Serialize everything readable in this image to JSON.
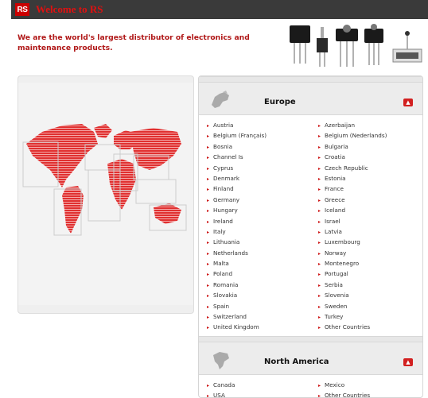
{
  "header": {
    "logo_text": "RS",
    "title": "Welcome to RS"
  },
  "tagline": "We are the world's largest distributor of electronics and maintenance products.",
  "regions": [
    {
      "name": "Europe",
      "countries": [
        "Austria",
        "Azerbaijan",
        "Belgium (Français)",
        "Belgium (Nederlands)",
        "Bosnia",
        "Bulgaria",
        "Channel Is",
        "Croatia",
        "Cyprus",
        "Czech Republic",
        "Denmark",
        "Estonia",
        "Finland",
        "France",
        "Germany",
        "Greece",
        "Hungary",
        "Iceland",
        "Ireland",
        "Israel",
        "Italy",
        "Latvia",
        "Lithuania",
        "Luxembourg",
        "Netherlands",
        "Norway",
        "Malta",
        "Montenegro",
        "Poland",
        "Portugal",
        "Romania",
        "Serbia",
        "Slovakia",
        "Slovenia",
        "Spain",
        "Sweden",
        "Switzerland",
        "Turkey",
        "United Kingdom",
        "Other Countries"
      ]
    },
    {
      "name": "North America",
      "countries": [
        "Canada",
        "Mexico",
        "USA",
        "Other Countries"
      ]
    }
  ],
  "icons": {
    "logo": "rs-logo",
    "europe": "europe-map-icon",
    "north_america": "north-america-map-icon",
    "up": "arrow-up-icon",
    "bullet": "chevron-right-icon"
  },
  "colors": {
    "brand_red": "#cc0000",
    "header_bg": "#3a3a3a",
    "map_red": "#e03030"
  }
}
